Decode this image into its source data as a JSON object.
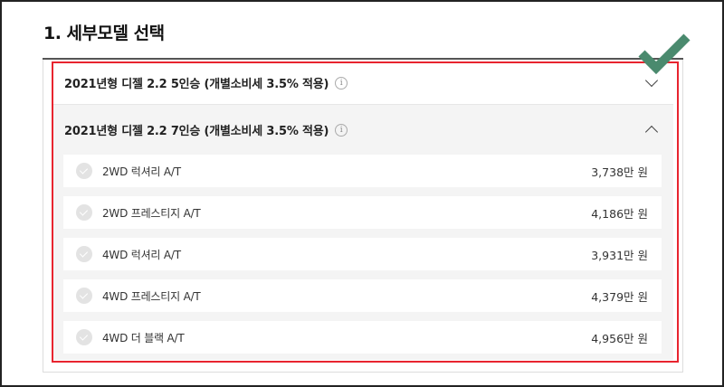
{
  "section": {
    "title": "1. 세부모델 선택"
  },
  "groups": [
    {
      "label": "2021년형 디젤 2.2 5인승 (개별소비세 3.5% 적용)",
      "info": "i",
      "state": "collapsed"
    },
    {
      "label": "2021년형 디젤 2.2 7인승 (개별소비세 3.5% 적용)",
      "info": "i",
      "state": "expanded"
    }
  ],
  "trims": [
    {
      "name": "2WD 럭셔리 A/T",
      "price": "3,738만 원"
    },
    {
      "name": "2WD 프레스티지 A/T",
      "price": "4,186만 원"
    },
    {
      "name": "4WD 럭셔리 A/T",
      "price": "3,931만 원"
    },
    {
      "name": "4WD 프레스티지 A/T",
      "price": "4,379만 원"
    },
    {
      "name": "4WD 더 블랙 A/T",
      "price": "4,956만 원"
    }
  ],
  "colors": {
    "highlight": "#e8242f",
    "check": "#4a8a6e"
  },
  "icons": {
    "checkmark": "checkmark-icon",
    "chevron": "chevron-icon",
    "info": "info-icon"
  }
}
